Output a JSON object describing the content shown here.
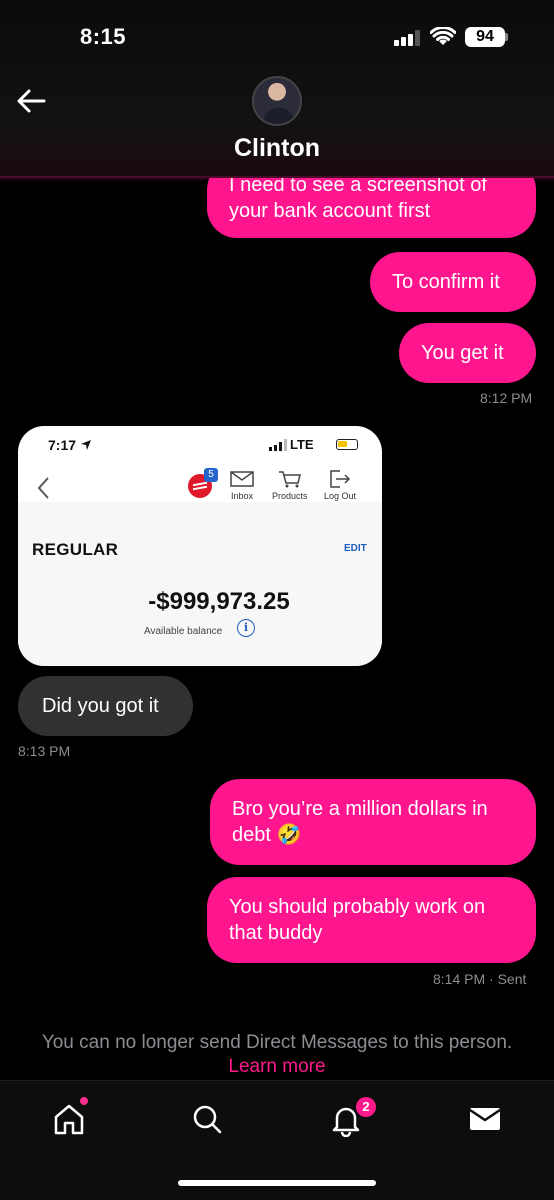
{
  "status_bar": {
    "time": "8:15",
    "battery": "94"
  },
  "header": {
    "contact_name": "Clinton"
  },
  "messages": {
    "m1": "I need to see a screenshot of your bank account first",
    "m2": "To confirm it",
    "m3": "You get it",
    "m3_time": "8:12 PM",
    "m4": "Did you got it",
    "m4_time": "8:13 PM",
    "m5": "Bro you’re a million dollars in debt 🤣",
    "m6": "You should probably work on that buddy",
    "m6_time": "8:14 PM",
    "m6_status": "· Sent"
  },
  "shared_screenshot": {
    "time": "7:17",
    "network": "LTE",
    "badge_count": "5",
    "nav": {
      "inbox": "Inbox",
      "products": "Products",
      "logout": "Log Out"
    },
    "account_name": "REGULAR",
    "edit_label": "EDIT",
    "balance": "-$999,973.25",
    "available_label": "Available balance",
    "info_glyph": "i"
  },
  "footer": {
    "notice": "You can no longer send Direct Messages to this person.",
    "learn_more": "Learn more"
  },
  "bottom_nav": {
    "notifications_badge": "2"
  },
  "colors": {
    "sent_bubble": "#ff168f",
    "received_bubble": "#2f3133",
    "accent": "#ff1a8c"
  }
}
